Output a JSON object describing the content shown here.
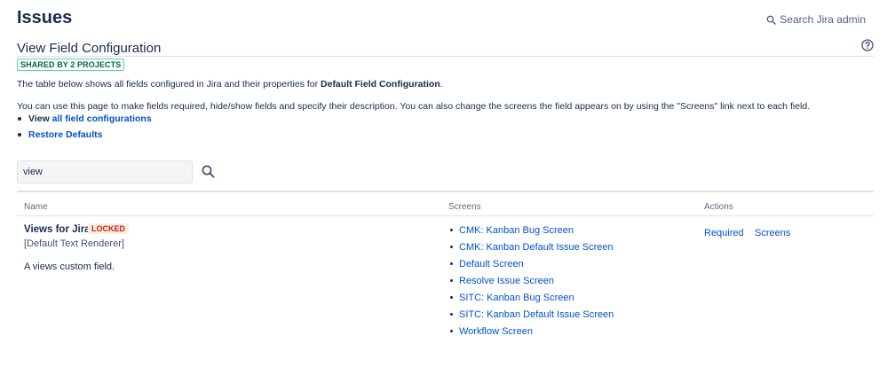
{
  "header": {
    "title": "Issues",
    "search_label": "Search Jira admin"
  },
  "section": {
    "title": "View Field Configuration",
    "shared_lozenge": "SHARED BY 2 PROJECTS",
    "help_icon": "question-circle-icon"
  },
  "description": {
    "line1_pre": "The table below shows all fields configured in Jira and their properties for ",
    "line1_bold": "Default Field Configuration",
    "line1_post": ".",
    "line2": "You can use this page to make fields required, hide/show fields and specify their description. You can also change the screens the field appears on by using the \"Screens\" link next to each field."
  },
  "links": {
    "view_prefix": "View ",
    "view_link": "all field configurations",
    "restore_link": "Restore Defaults"
  },
  "filter": {
    "value": "view",
    "search_icon": "search-icon"
  },
  "table": {
    "headers": {
      "name": "Name",
      "screens": "Screens",
      "actions": "Actions"
    },
    "row": {
      "name": "Views for Jira",
      "locked_lozenge": "LOCKED",
      "renderer": "[Default Text Renderer]",
      "description": "A views custom field.",
      "screens": [
        "CMK: Kanban Bug Screen",
        "CMK: Kanban Default Issue Screen",
        "Default Screen",
        "Resolve Issue Screen",
        "SITC: Kanban Bug Screen",
        "SITC: Kanban Default Issue Screen",
        "Workflow Screen"
      ],
      "actions": {
        "required": "Required",
        "screens": "Screens"
      }
    }
  },
  "colors": {
    "link": "#0052cc",
    "text": "#172b4d",
    "shared_lozenge": "#006644",
    "locked_lozenge": "#bf2600",
    "locked_bg": "#ffebe6"
  }
}
